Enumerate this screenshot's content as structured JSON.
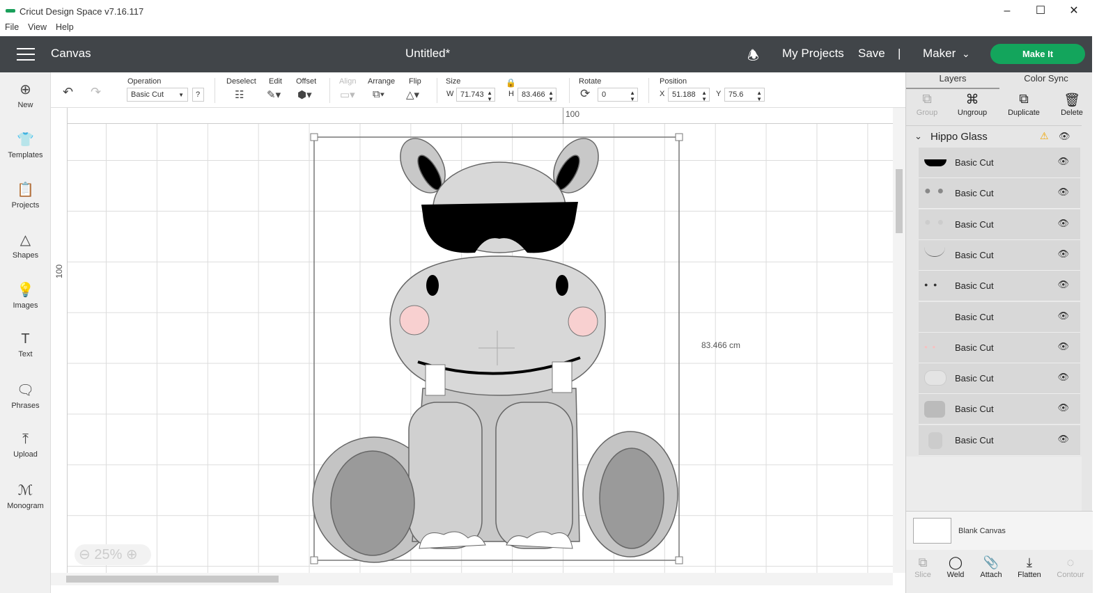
{
  "window": {
    "title": "Cricut Design Space  v7.16.117",
    "controls": [
      "minimize",
      "maximize",
      "close"
    ]
  },
  "menu": [
    "File",
    "View",
    "Help"
  ],
  "header": {
    "section": "Canvas",
    "doc_title": "Untitled*",
    "my_projects": "My Projects",
    "save": "Save",
    "separator": "|",
    "machine": "Maker",
    "make_it": "Make It"
  },
  "sidebar": [
    {
      "label": "New",
      "icon": "plus-circle"
    },
    {
      "label": "Templates",
      "icon": "shirt"
    },
    {
      "label": "Projects",
      "icon": "clipboard"
    },
    {
      "label": "Shapes",
      "icon": "shapes"
    },
    {
      "label": "Images",
      "icon": "lightbulb"
    },
    {
      "label": "Text",
      "icon": "text-T"
    },
    {
      "label": "Phrases",
      "icon": "speech-bubble"
    },
    {
      "label": "Upload",
      "icon": "upload"
    },
    {
      "label": "Monogram",
      "icon": "monogram"
    }
  ],
  "toolbar": {
    "operation_label": "Operation",
    "operation_value": "Basic Cut",
    "help": "?",
    "deselect": "Deselect",
    "edit": "Edit",
    "offset": "Offset",
    "align": "Align",
    "arrange": "Arrange",
    "flip": "Flip",
    "size": "Size",
    "w_label": "W",
    "w": "71.743",
    "h_label": "H",
    "h": "83.466",
    "rotate": "Rotate",
    "rotate_value": "0",
    "position": "Position",
    "x_label": "X",
    "x": "51.188",
    "y_label": "Y",
    "y": "75.6"
  },
  "canvas": {
    "ruler_top": "100",
    "ruler_left": "100",
    "dimension_label": "83.466 cm",
    "zoom": "25%"
  },
  "panel": {
    "tabs": [
      "Layers",
      "Color Sync"
    ],
    "actions": [
      "Group",
      "Ungroup",
      "Duplicate",
      "Delete"
    ],
    "group_name": "Hippo Glass",
    "layers": [
      "Basic Cut",
      "Basic Cut",
      "Basic Cut",
      "Basic Cut",
      "Basic Cut",
      "Basic Cut",
      "Basic Cut",
      "Basic Cut",
      "Basic Cut",
      "Basic Cut"
    ],
    "blank_canvas": "Blank Canvas",
    "bottom_actions": [
      "Slice",
      "Weld",
      "Attach",
      "Flatten",
      "Contour"
    ]
  },
  "colors": {
    "header": "#414549",
    "accent": "#13a55c",
    "warning": "#f0a500"
  }
}
